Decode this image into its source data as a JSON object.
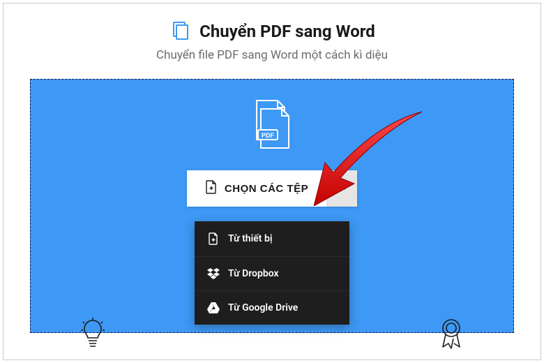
{
  "header": {
    "title": "Chuyển PDF sang Word",
    "subtitle": "Chuyển file PDF sang Word một cách kì diệu"
  },
  "uploader": {
    "choose_label": "CHỌN CÁC TỆP",
    "dropdown": [
      {
        "label": "Từ thiết bị"
      },
      {
        "label": "Từ Dropbox"
      },
      {
        "label": "Từ Google Drive"
      }
    ]
  },
  "colors": {
    "accent": "#3d99f5",
    "arrow": "#ef1b1b"
  }
}
